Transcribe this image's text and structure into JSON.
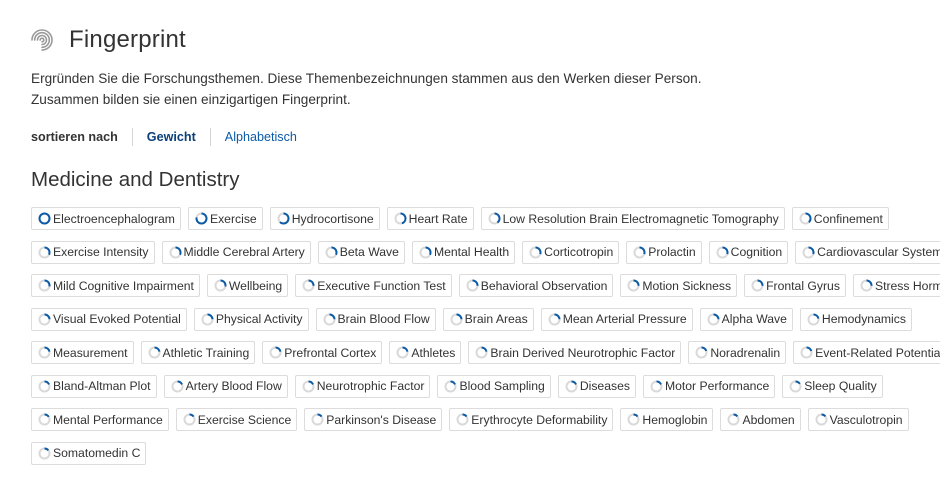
{
  "header": {
    "title": "Fingerprint",
    "icon": "fingerprint-icon"
  },
  "description": {
    "line1": "Ergründen Sie die Forschungsthemen. Diese Themenbezeichnungen stammen aus den Werken dieser Person.",
    "line2": "Zusammen bilden sie einen einzigartigen Fingerprint."
  },
  "sort": {
    "label": "sortieren nach",
    "options": [
      "Gewicht",
      "Alphabetisch"
    ],
    "selected": "Gewicht"
  },
  "section": {
    "title": "Medicine and Dentistry"
  },
  "colors": {
    "accent": "#0b5aa6",
    "ring_track": "#d9d9d9"
  },
  "concepts": [
    {
      "label": "Electroencephalogram",
      "weight": 1.0
    },
    {
      "label": "Exercise",
      "weight": 0.78
    },
    {
      "label": "Hydrocortisone",
      "weight": 0.62
    },
    {
      "label": "Heart Rate",
      "weight": 0.45
    },
    {
      "label": "Low Resolution Brain Electromagnetic Tomography",
      "weight": 0.4
    },
    {
      "label": "Confinement",
      "weight": 0.38
    },
    {
      "label": "Exercise Intensity",
      "weight": 0.32
    },
    {
      "label": "Middle Cerebral Artery",
      "weight": 0.32
    },
    {
      "label": "Beta Wave",
      "weight": 0.32
    },
    {
      "label": "Mental Health",
      "weight": 0.32
    },
    {
      "label": "Corticotropin",
      "weight": 0.3
    },
    {
      "label": "Prolactin",
      "weight": 0.3
    },
    {
      "label": "Cognition",
      "weight": 0.3
    },
    {
      "label": "Cardiovascular System",
      "weight": 0.3
    },
    {
      "label": "Mild Cognitive Impairment",
      "weight": 0.28
    },
    {
      "label": "Wellbeing",
      "weight": 0.28
    },
    {
      "label": "Executive Function Test",
      "weight": 0.26
    },
    {
      "label": "Behavioral Observation",
      "weight": 0.26
    },
    {
      "label": "Motion Sickness",
      "weight": 0.26
    },
    {
      "label": "Frontal Gyrus",
      "weight": 0.26
    },
    {
      "label": "Stress Hormone",
      "weight": 0.26
    },
    {
      "label": "Visual Evoked Potential",
      "weight": 0.24
    },
    {
      "label": "Physical Activity",
      "weight": 0.24
    },
    {
      "label": "Brain Blood Flow",
      "weight": 0.24
    },
    {
      "label": "Brain Areas",
      "weight": 0.24
    },
    {
      "label": "Mean Arterial Pressure",
      "weight": 0.24
    },
    {
      "label": "Alpha Wave",
      "weight": 0.24
    },
    {
      "label": "Hemodynamics",
      "weight": 0.22
    },
    {
      "label": "Measurement",
      "weight": 0.22
    },
    {
      "label": "Athletic Training",
      "weight": 0.22
    },
    {
      "label": "Prefrontal Cortex",
      "weight": 0.22
    },
    {
      "label": "Athletes",
      "weight": 0.22
    },
    {
      "label": "Brain Derived Neurotrophic Factor",
      "weight": 0.22
    },
    {
      "label": "Noradrenalin",
      "weight": 0.2
    },
    {
      "label": "Event-Related Potential",
      "weight": 0.2
    },
    {
      "label": "Bland-Altman Plot",
      "weight": 0.18
    },
    {
      "label": "Artery Blood Flow",
      "weight": 0.18
    },
    {
      "label": "Neurotrophic Factor",
      "weight": 0.18
    },
    {
      "label": "Blood Sampling",
      "weight": 0.18
    },
    {
      "label": "Diseases",
      "weight": 0.18
    },
    {
      "label": "Motor Performance",
      "weight": 0.18
    },
    {
      "label": "Sleep Quality",
      "weight": 0.16
    },
    {
      "label": "Mental Performance",
      "weight": 0.16
    },
    {
      "label": "Exercise Science",
      "weight": 0.15
    },
    {
      "label": "Parkinson's Disease",
      "weight": 0.15
    },
    {
      "label": "Erythrocyte Deformability",
      "weight": 0.15
    },
    {
      "label": "Hemoglobin",
      "weight": 0.15
    },
    {
      "label": "Abdomen",
      "weight": 0.14
    },
    {
      "label": "Vasculotropin",
      "weight": 0.14
    },
    {
      "label": "Somatomedin C",
      "weight": 0.14
    }
  ]
}
